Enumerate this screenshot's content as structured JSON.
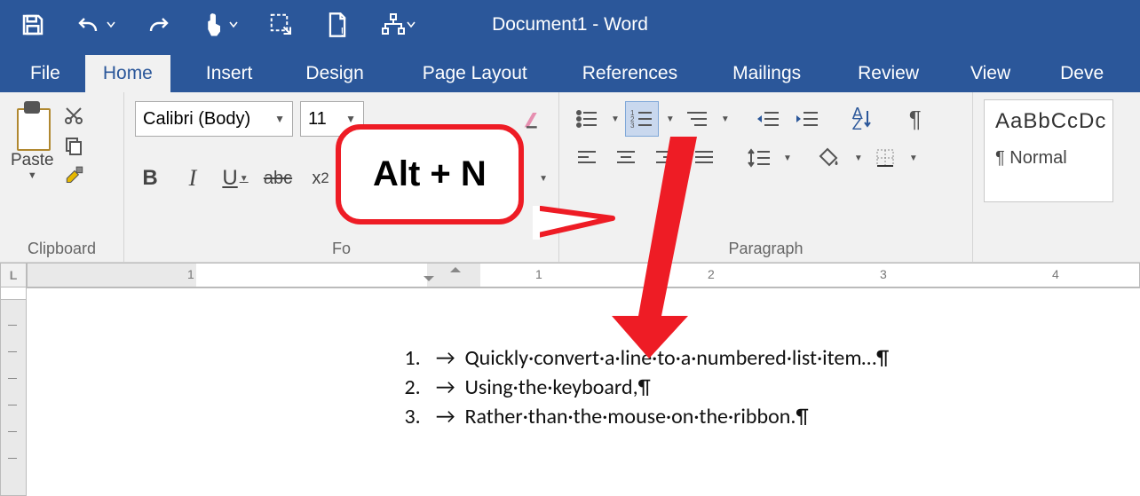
{
  "app": {
    "title": "Document1 - Word"
  },
  "tabs": {
    "file": "File",
    "home": "Home",
    "insert": "Insert",
    "design": "Design",
    "layout": "Page Layout",
    "references": "References",
    "mailings": "Mailings",
    "review": "Review",
    "view": "View",
    "developer": "Deve"
  },
  "clipboard": {
    "paste": "Paste",
    "label": "Clipboard"
  },
  "font": {
    "name": "Calibri (Body)",
    "size": "11",
    "label": "Fo"
  },
  "paragraph": {
    "label": "Paragraph"
  },
  "styles": {
    "sample": "AaBbCcDc",
    "name": "¶ Normal"
  },
  "callout": {
    "text": "Alt + N"
  },
  "ruler": {
    "n1": "1",
    "n2": "1",
    "n3": "2",
    "n4": "3",
    "n5": "4"
  },
  "vruler_head": "L",
  "doc": {
    "lines": [
      {
        "num": "1.",
        "text": "Quickly·convert·a·line·to·a·numbered·list·item…¶"
      },
      {
        "num": "2.",
        "text": "Using·the·keyboard,¶"
      },
      {
        "num": "3.",
        "text": "Rather·than·the·mouse·on·the·ribbon.¶"
      }
    ]
  }
}
